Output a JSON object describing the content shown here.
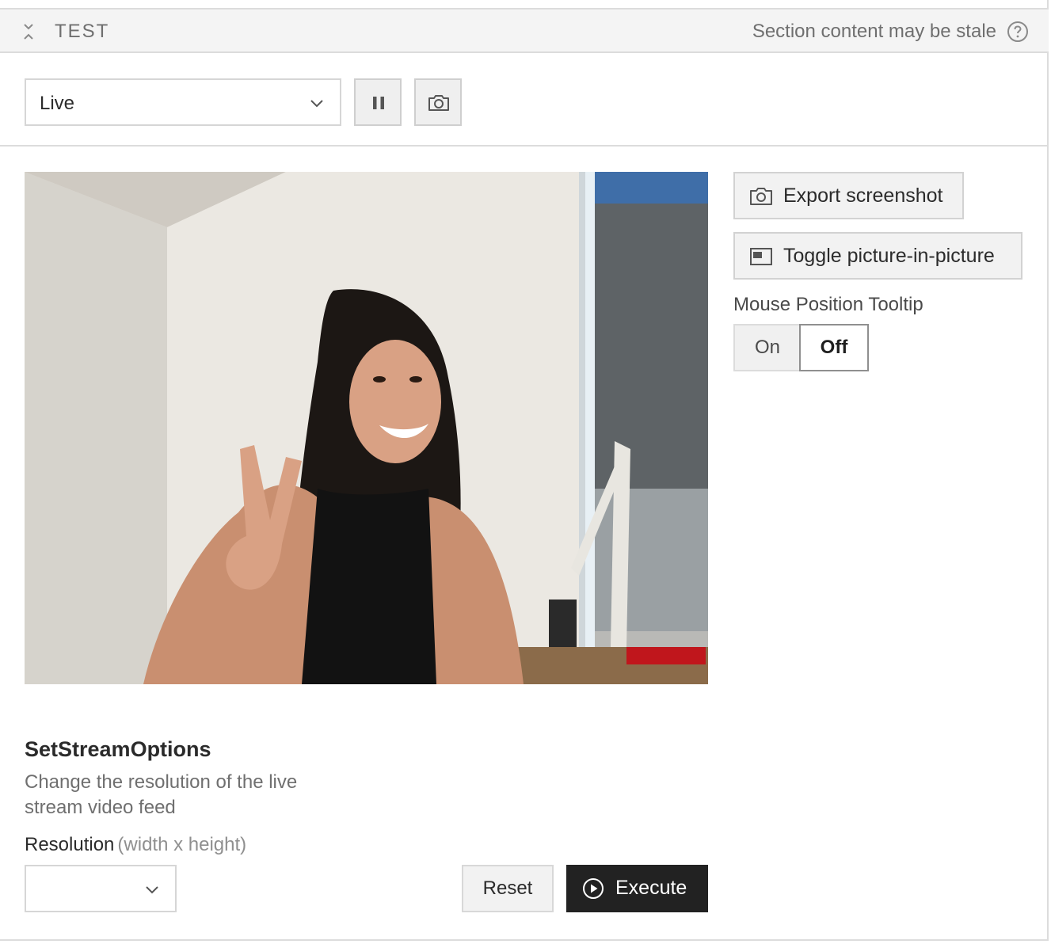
{
  "section": {
    "title": "TEST",
    "stale_notice": "Section content may be stale"
  },
  "toolbar": {
    "mode_select_value": "Live"
  },
  "icons": {
    "collapse": "collapse-arrows-icon",
    "help": "help-circle-icon",
    "chevron": "chevron-down-icon",
    "pause": "pause-icon",
    "camera": "camera-icon",
    "pip": "picture-in-picture-icon",
    "play": "play-circle-icon"
  },
  "side_panel": {
    "export_label": "Export screenshot",
    "pip_label": "Toggle picture-in-picture",
    "tooltip_label": "Mouse Position Tooltip",
    "tooltip_on": "On",
    "tooltip_off": "Off",
    "tooltip_selected": "Off"
  },
  "form": {
    "title": "SetStreamOptions",
    "description": "Change the resolution of the live stream video feed",
    "resolution_label": "Resolution",
    "resolution_hint": "(width x height)",
    "resolution_value": "",
    "reset_label": "Reset",
    "execute_label": "Execute"
  },
  "colors": {
    "header_bg": "#f4f4f4",
    "execute_bg": "#222222",
    "muted_text": "#6f6f6f"
  }
}
